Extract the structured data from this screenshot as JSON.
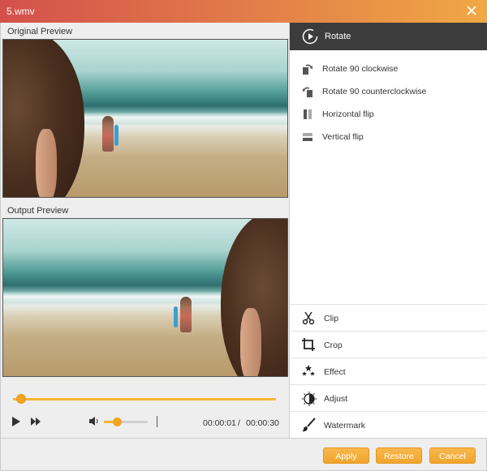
{
  "window": {
    "title": "5.wmv"
  },
  "preview": {
    "original_label": "Original Preview",
    "output_label": "Output Preview"
  },
  "player": {
    "progress_fraction": 0.03,
    "volume_fraction": 0.3,
    "current_time": "00:00:01",
    "separator": "/",
    "total_time": "00:00:30"
  },
  "rotate": {
    "header_label": "Rotate",
    "items": [
      {
        "label": "Rotate 90 clockwise",
        "icon": "rotate-clockwise-icon"
      },
      {
        "label": "Rotate 90 counterclockwise",
        "icon": "rotate-counterclockwise-icon"
      },
      {
        "label": "Horizontal flip",
        "icon": "horizontal-flip-icon"
      },
      {
        "label": "Vertical flip",
        "icon": "vertical-flip-icon"
      }
    ]
  },
  "tools": [
    {
      "label": "Clip",
      "icon": "scissors-icon"
    },
    {
      "label": "Crop",
      "icon": "crop-icon"
    },
    {
      "label": "Effect",
      "icon": "stars-icon"
    },
    {
      "label": "Adjust",
      "icon": "contrast-icon"
    },
    {
      "label": "Watermark",
      "icon": "brush-icon"
    }
  ],
  "buttons": {
    "apply": "Apply",
    "restore": "Restore",
    "cancel": "Cancel"
  },
  "colors": {
    "accent": "#f0a52d",
    "header_dark": "#3c3c3c",
    "title_start": "#d4504b",
    "title_end": "#f0a844"
  }
}
